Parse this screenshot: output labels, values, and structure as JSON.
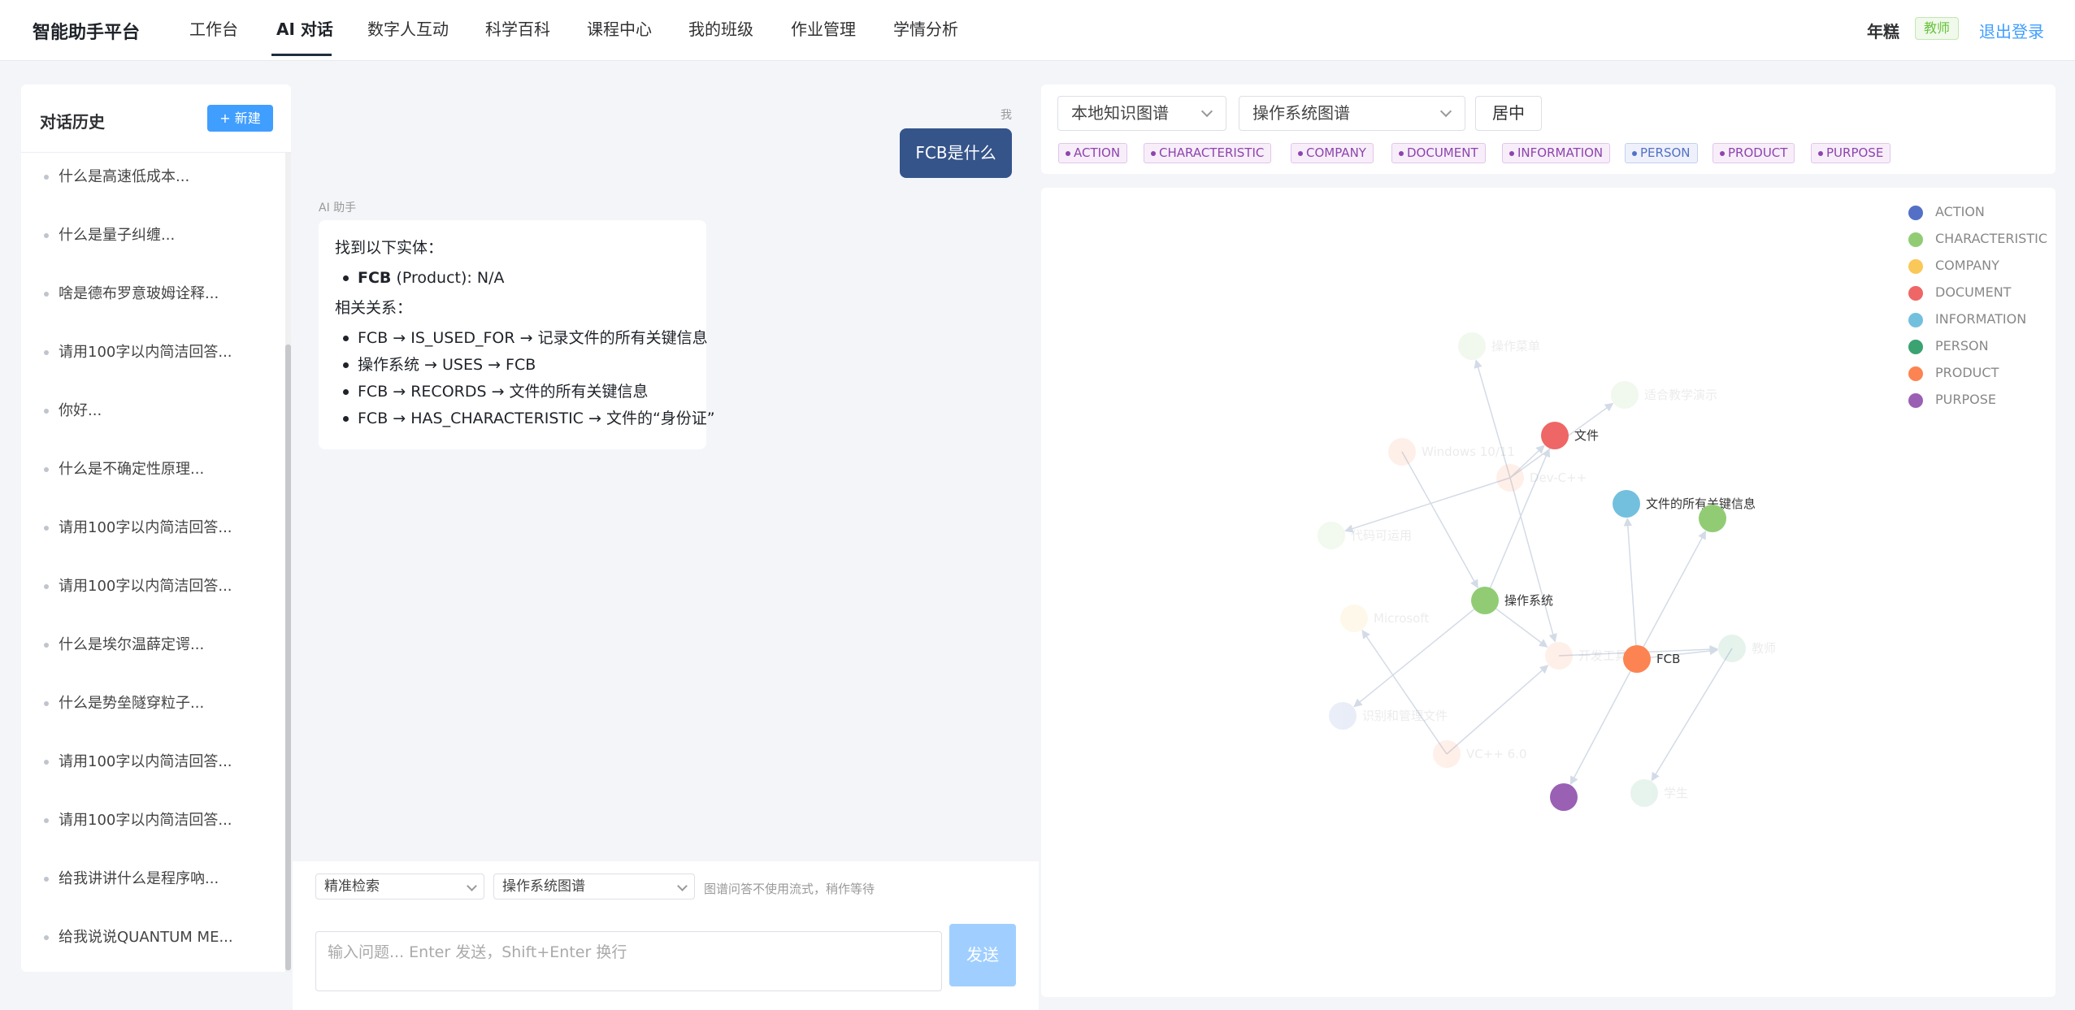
{
  "nav": {
    "brand": "智能助手平台",
    "items": [
      {
        "label": "工作台",
        "active": false
      },
      {
        "label": "AI 对话",
        "active": true
      },
      {
        "label": "数字人互动",
        "active": false
      },
      {
        "label": "科学百科",
        "active": false
      },
      {
        "label": "课程中心",
        "active": false
      },
      {
        "label": "我的班级",
        "active": false
      },
      {
        "label": "作业管理",
        "active": false
      },
      {
        "label": "学情分析",
        "active": false
      }
    ],
    "user_name": "年糕",
    "role": "教师",
    "logout": "退出登录"
  },
  "sidebar": {
    "title": "对话历史",
    "new_button": "+ 新建",
    "items": [
      "什么是高速低成本...",
      "什么是量子纠缠...",
      "啥是德布罗意玻姆诠释...",
      "请用100字以内简洁回答...",
      "你好...",
      "什么是不确定性原理...",
      "请用100字以内简洁回答...",
      "请用100字以内简洁回答...",
      "什么是埃尔温薛定谔...",
      "什么是势垒隧穿粒子...",
      "请用100字以内简洁回答...",
      "请用100字以内简洁回答...",
      "给我讲讲什么是程序吶...",
      "给我说说QUANTUM ME..."
    ]
  },
  "chat": {
    "me_label": "我",
    "user_message": "FCB是什么",
    "ai_label": "AI 助手",
    "ai": {
      "entities_heading": "找到以下实体：",
      "entity_name": "FCB",
      "entity_detail": " (Product): N/A",
      "relations_heading": "相关关系：",
      "relations": [
        "FCB → IS_USED_FOR → 记录文件的所有关键信息",
        "操作系统 → USES → FCB",
        "FCB → RECORDS → 文件的所有关键信息",
        "FCB → HAS_CHARACTERISTIC → 文件的“身份证”"
      ]
    },
    "mode_select": "精准检索",
    "graph_select": "操作系统图谱",
    "hint": "图谱问答不使用流式，稍作等待",
    "input_placeholder": "输入问题... Enter 发送，Shift+Enter 换行",
    "send": "发送"
  },
  "graph_panel": {
    "source_select": "本地知识图谱",
    "graph_select": "操作系统图谱",
    "center_button": "居中",
    "tags": [
      "ACTION",
      "CHARACTERISTIC",
      "COMPANY",
      "DOCUMENT",
      "INFORMATION",
      "PERSON",
      "PRODUCT",
      "PURPOSE"
    ],
    "legend": [
      {
        "label": "ACTION",
        "color": "#5470c6"
      },
      {
        "label": "CHARACTERISTIC",
        "color": "#91cc75"
      },
      {
        "label": "COMPANY",
        "color": "#fac858"
      },
      {
        "label": "DOCUMENT",
        "color": "#ee6666"
      },
      {
        "label": "INFORMATION",
        "color": "#73c0de"
      },
      {
        "label": "PERSON",
        "color": "#3ba272"
      },
      {
        "label": "PRODUCT",
        "color": "#fc8452"
      },
      {
        "label": "PURPOSE",
        "color": "#9a60b4"
      }
    ],
    "nodes": [
      {
        "label": "操作菜单",
        "color": "#91cc75",
        "faded": true
      },
      {
        "label": "适合教学演示",
        "color": "#91cc75",
        "faded": true
      },
      {
        "label": "文件",
        "color": "#ee6666",
        "faded": false
      },
      {
        "label": "Windows 10/11",
        "color": "#fc8452",
        "faded": true
      },
      {
        "label": "Dev-C++",
        "color": "#fc8452",
        "faded": true
      },
      {
        "label": "文件的所有关键信息",
        "color": "#73c0de",
        "faded": false
      },
      {
        "label": "",
        "color": "#91cc75",
        "faded": false
      },
      {
        "label": "代码可运用",
        "color": "#91cc75",
        "faded": true
      },
      {
        "label": "操作系统",
        "color": "#91cc75",
        "faded": false
      },
      {
        "label": "Microsoft",
        "color": "#fac858",
        "faded": true
      },
      {
        "label": "教师",
        "color": "#3ba272",
        "faded": true
      },
      {
        "label": "开发工具",
        "color": "#fc8452",
        "faded": true
      },
      {
        "label": "FCB",
        "color": "#fc8452",
        "faded": false
      },
      {
        "label": "识别和管理文件",
        "color": "#5470c6",
        "faded": true
      },
      {
        "label": "VC++ 6.0",
        "color": "#fc8452",
        "faded": true
      },
      {
        "label": "",
        "color": "#9a60b4",
        "faded": false
      },
      {
        "label": "学生",
        "color": "#3ba272",
        "faded": true
      }
    ]
  }
}
